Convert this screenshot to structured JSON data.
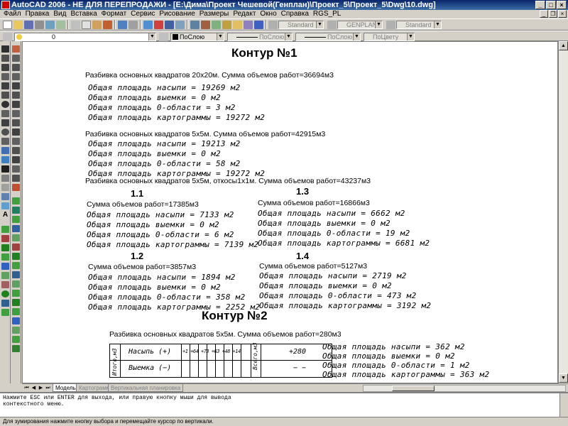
{
  "window": {
    "title": "AutoCAD 2006 - НЕ ДЛЯ ПЕРЕПРОДАЖИ - [E:\\Дима\\Проект Чешевой(Генплан)\\Проект_5\\Проект_5\\Dwg\\10.dwg]"
  },
  "menu": [
    "Файл",
    "Правка",
    "Вид",
    "Вставка",
    "Формат",
    "Сервис",
    "Рисование",
    "Размеры",
    "Редакт",
    "Окно",
    "Справка",
    "RGS_PL"
  ],
  "toolbar": {
    "text_style": "Standard",
    "dim_style": "GENPLAN",
    "table_style": "Standard",
    "layer": "0",
    "color": "ПоСлою",
    "linetype": "ПоСлою",
    "lineweight": "ПоСлою",
    "plot_style": "ПоЦвету"
  },
  "drawing": {
    "contour1_title": "Контур №1",
    "block_a": {
      "header": "Разбивка основных квадратов 20х20м. Сумма объемов работ=36694м3",
      "lines": [
        "Общая площадь насыпи = 19269 м2",
        "Общая площадь выемки = 0 м2",
        "Общая площадь 0-области = 3 м2",
        "Общая площадь картограммы = 19272 м2"
      ]
    },
    "block_b": {
      "header": "Разбивка основных квадратов 5х5м. Сумма объемов работ=42915м3",
      "lines": [
        "Общая площадь насыпи = 19213 м2",
        "Общая площадь выемки = 0 м2",
        "Общая площадь 0-области = 58 м2",
        "Общая площадь картограммы = 19272 м2"
      ]
    },
    "block_c_header": "Разбивка основных квадратов 5х5м, откосы1х1м. Сумма объемов работ=43237м3",
    "sections": [
      {
        "label": "1.1",
        "sum": "Сумма объемов работ=17385м3",
        "lines": [
          "Общая площадь насыпи = 7133 м2",
          "Общая площадь выемки = 0 м2",
          "Общая площадь 0-области = 6 м2",
          "Общая площадь картограммы = 7139 м2"
        ]
      },
      {
        "label": "1.3",
        "sum": "Сумма объемов работ=16866м3",
        "lines": [
          "Общая площадь насыпи = 6662 м2",
          "Общая площадь выемки = 0 м2",
          "Общая площадь 0-области = 19 м2",
          "Общая площадь картограммы = 6681 м2"
        ]
      },
      {
        "label": "1.2",
        "sum": "Сумма объемов работ=3857м3",
        "lines": [
          "Общая площадь насыпи = 1894 м2",
          "Общая площадь выемки = 0 м2",
          "Общая площадь 0-области = 358 м2",
          "Общая площадь картограммы = 2252 м2"
        ]
      },
      {
        "label": "1.4",
        "sum": "Сумма объемов работ=5127м3",
        "lines": [
          "Общая площадь насыпи = 2719 м2",
          "Общая площадь выемки = 0 м2",
          "Общая площадь 0-области = 473 м2",
          "Общая площадь картограммы = 3192 м2"
        ]
      }
    ],
    "contour2_title": "Контур №2",
    "contour2_header": "Разбивка основных квадратов 5х5м. Сумма объемов работ=280м3",
    "table": {
      "side_label": "Итого,м3",
      "row1_label": "Насыпь (+)",
      "row2_label": "Выемка (−)",
      "mid_cells": "+1 +64 +73 +63 +48 +14",
      "total_label": "Всего,м3",
      "row1_total": "+280",
      "row2_total": "− −"
    },
    "contour2_lines": [
      "Общая площадь насыпи = 362 м2",
      "Общая площадь выемки = 0 м2",
      "Общая площадь 0-области = 1 м2",
      "Общая площадь картограммы = 363 м2"
    ]
  },
  "tabs": {
    "model": "Модель",
    "layout1": "Картограмма",
    "layout2": "Вертикальная планировка"
  },
  "command_line": {
    "line1": "Нажмите ESC или ENTER для выхода, или правую кнопку мыши для вывода",
    "line2": "контекстного меню."
  },
  "status_bar": "Для зумирования нажмите кнопку выбора и перемещайте курсор по вертикали."
}
